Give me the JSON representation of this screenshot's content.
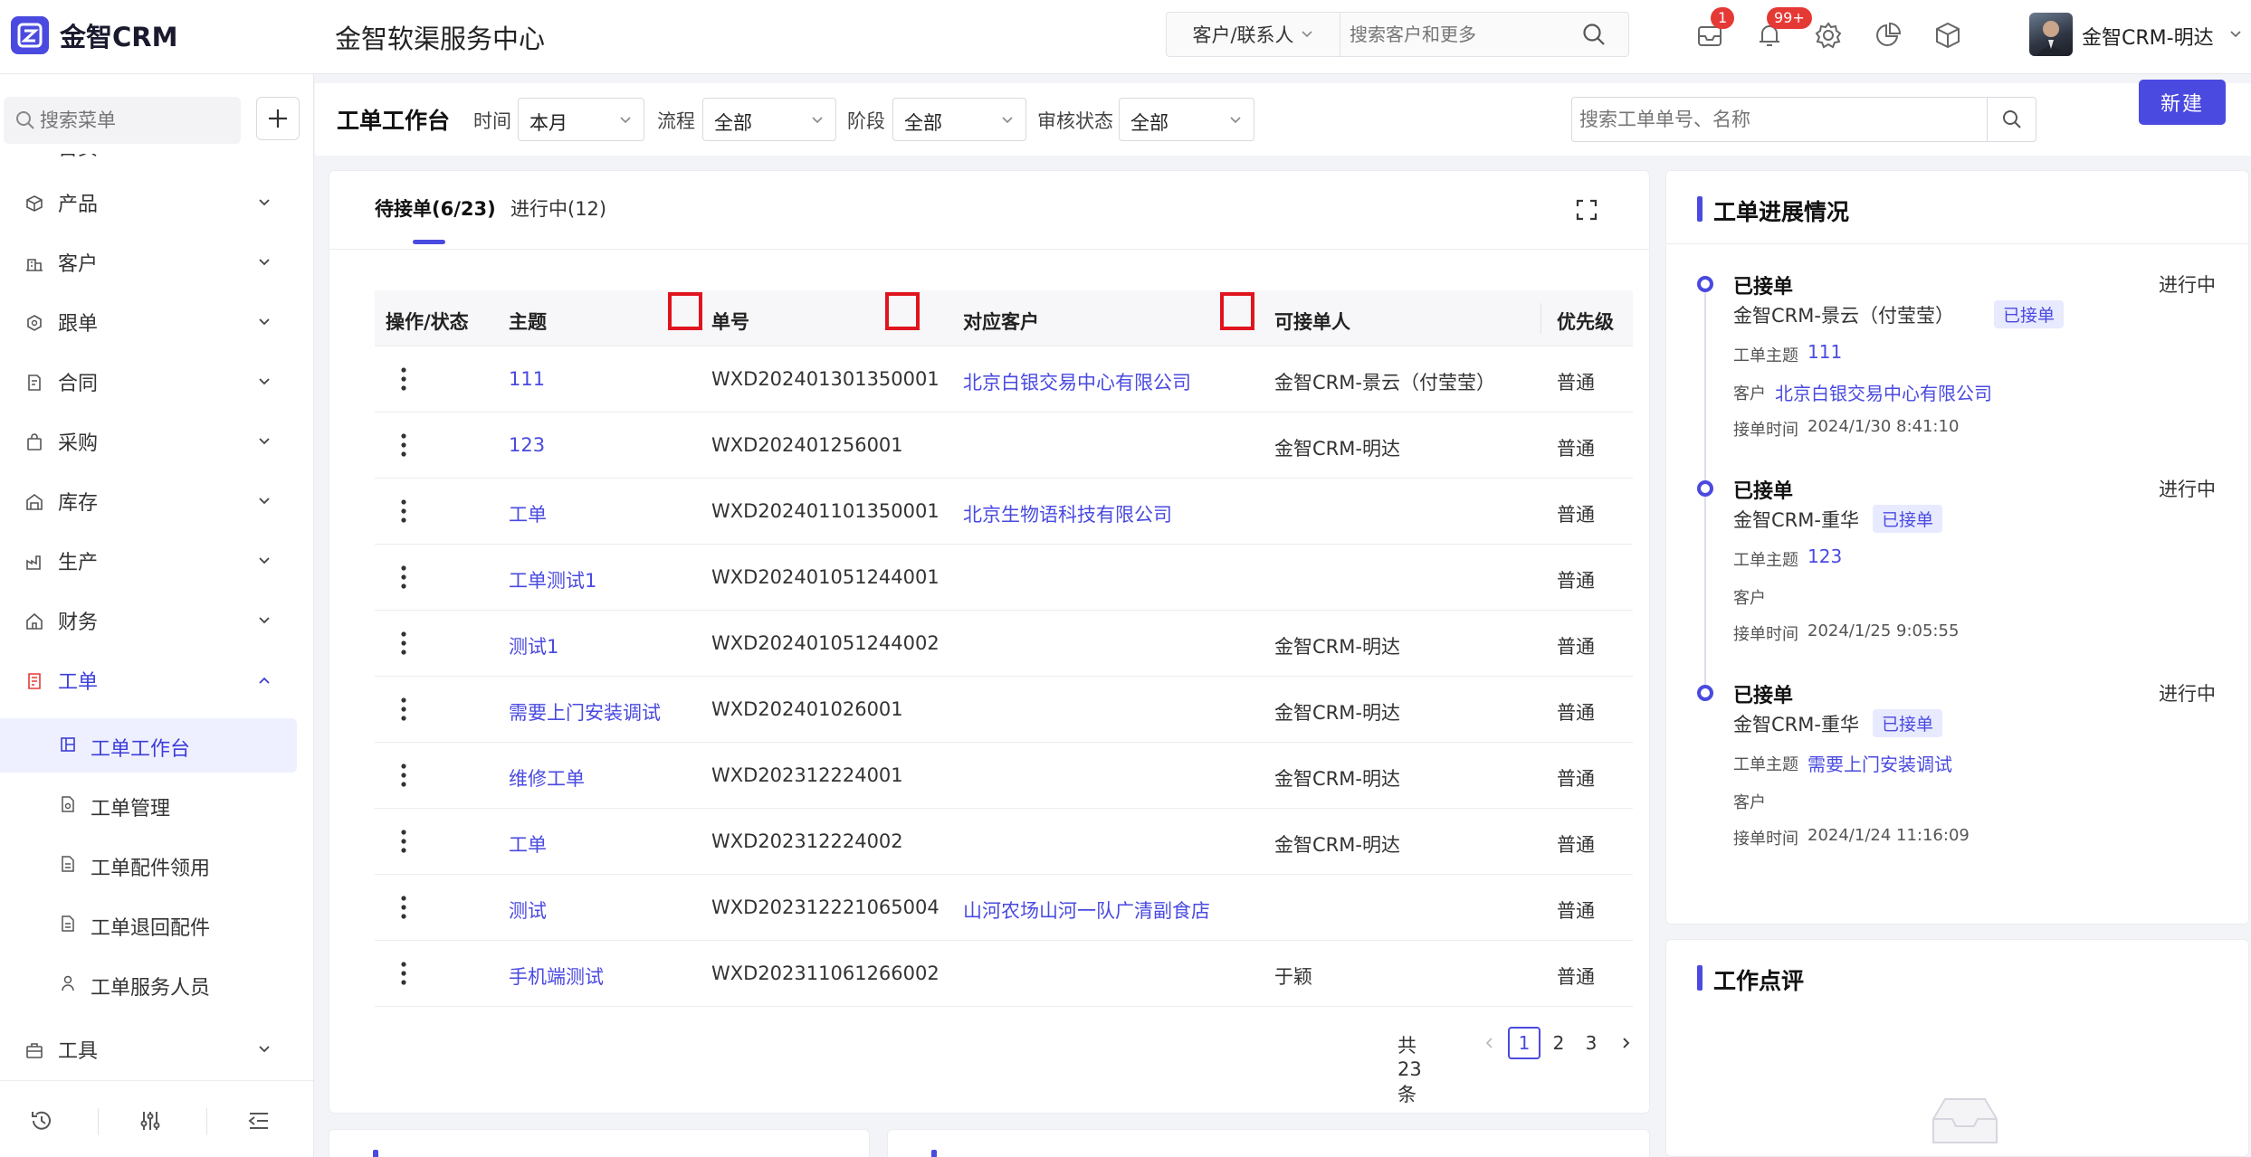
{
  "header": {
    "logo_text": "金智CRM",
    "center_title": "金智软渠服务中心",
    "search_type": "客户/联系人",
    "search_placeholder": "搜索客户和更多",
    "badge_messages": "1",
    "badge_notifications": "99+",
    "user_name": "金智CRM-明达"
  },
  "sidebar": {
    "search_placeholder": "搜索菜单",
    "partial_top": "首页",
    "items": [
      {
        "label": "产品",
        "icon": "cube-icon"
      },
      {
        "label": "客户",
        "icon": "building-icon"
      },
      {
        "label": "跟单",
        "icon": "hex-icon"
      },
      {
        "label": "合同",
        "icon": "contract-icon"
      },
      {
        "label": "采购",
        "icon": "bag-icon"
      },
      {
        "label": "库存",
        "icon": "warehouse-icon"
      },
      {
        "label": "生产",
        "icon": "factory-icon"
      },
      {
        "label": "财务",
        "icon": "home-icon"
      },
      {
        "label": "工单",
        "icon": "workorder-icon"
      }
    ],
    "sub_items": [
      {
        "label": "工单工作台",
        "icon": "layout-icon"
      },
      {
        "label": "工单管理",
        "icon": "file-gear-icon"
      },
      {
        "label": "工单配件领用",
        "icon": "file-icon"
      },
      {
        "label": "工单退回配件",
        "icon": "file-icon"
      },
      {
        "label": "工单服务人员",
        "icon": "person-icon"
      }
    ],
    "tools_label": "工具"
  },
  "filters": {
    "title": "工单工作台",
    "time_label": "时间",
    "time_value": "本月",
    "flow_label": "流程",
    "flow_value": "全部",
    "stage_label": "阶段",
    "stage_value": "全部",
    "audit_label": "审核状态",
    "audit_value": "全部",
    "search_placeholder": "搜索工单单号、名称",
    "new_button": "新建"
  },
  "tabs": {
    "pending": "待接单(6/23)",
    "in_progress": "进行中(12)"
  },
  "table": {
    "columns": [
      "操作/状态",
      "主题",
      "单号",
      "对应客户",
      "可接单人",
      "优先级"
    ],
    "rows": [
      {
        "subject": "111",
        "number": "WXD202401301350001",
        "customer": "北京白银交易中心有限公司",
        "assignee": "金智CRM-景云（付莹莹）",
        "priority": "普通"
      },
      {
        "subject": "123",
        "number": "WXD202401256001",
        "customer": "",
        "assignee": "金智CRM-明达",
        "priority": "普通"
      },
      {
        "subject": "工单",
        "number": "WXD202401101350001",
        "customer": "北京生物语科技有限公司",
        "assignee": "",
        "priority": "普通"
      },
      {
        "subject": "工单测试1",
        "number": "WXD202401051244001",
        "customer": "",
        "assignee": "",
        "priority": "普通"
      },
      {
        "subject": "测试1",
        "number": "WXD202401051244002",
        "customer": "",
        "assignee": "金智CRM-明达",
        "priority": "普通"
      },
      {
        "subject": "需要上门安装调试",
        "number": "WXD202401026001",
        "customer": "",
        "assignee": "金智CRM-明达",
        "priority": "普通"
      },
      {
        "subject": "维修工单",
        "number": "WXD202312224001",
        "customer": "",
        "assignee": "金智CRM-明达",
        "priority": "普通"
      },
      {
        "subject": "工单",
        "number": "WXD202312224002",
        "customer": "",
        "assignee": "金智CRM-明达",
        "priority": "普通"
      },
      {
        "subject": "测试",
        "number": "WXD202312221065004",
        "customer": "山河农场山河一队广清副食店",
        "assignee": "",
        "priority": "普通"
      },
      {
        "subject": "手机端测试",
        "number": "WXD202311061266002",
        "customer": "",
        "assignee": "于颖",
        "priority": "普通"
      }
    ]
  },
  "pagination": {
    "total": "共23条",
    "pages": [
      "1",
      "2",
      "3"
    ],
    "current": "1"
  },
  "progress_panel": {
    "title": "工单进展情况",
    "entries": [
      {
        "status": "已接单",
        "state": "进行中",
        "person": "金智CRM-景云（付莹莹）",
        "badge": "已接单",
        "subject_label": "工单主题",
        "subject": "111",
        "customer_label": "客户",
        "customer": "北京白银交易中心有限公司",
        "time_label": "接单时间",
        "time": "2024/1/30 8:41:10"
      },
      {
        "status": "已接单",
        "state": "进行中",
        "person": "金智CRM-重华",
        "badge": "已接单",
        "subject_label": "工单主题",
        "subject": "123",
        "customer_label": "客户",
        "customer": "",
        "time_label": "接单时间",
        "time": "2024/1/25 9:05:55"
      },
      {
        "status": "已接单",
        "state": "进行中",
        "person": "金智CRM-重华",
        "badge": "已接单",
        "subject_label": "工单主题",
        "subject": "需要上门安装调试",
        "customer_label": "客户",
        "customer": "",
        "time_label": "接单时间",
        "time": "2024/1/24 11:16:09"
      }
    ]
  },
  "review_panel": {
    "title": "工作点评"
  },
  "colors": {
    "accent": "#4a4ae0",
    "highlight_box": "#e0141e",
    "badge_red": "#e53935"
  }
}
